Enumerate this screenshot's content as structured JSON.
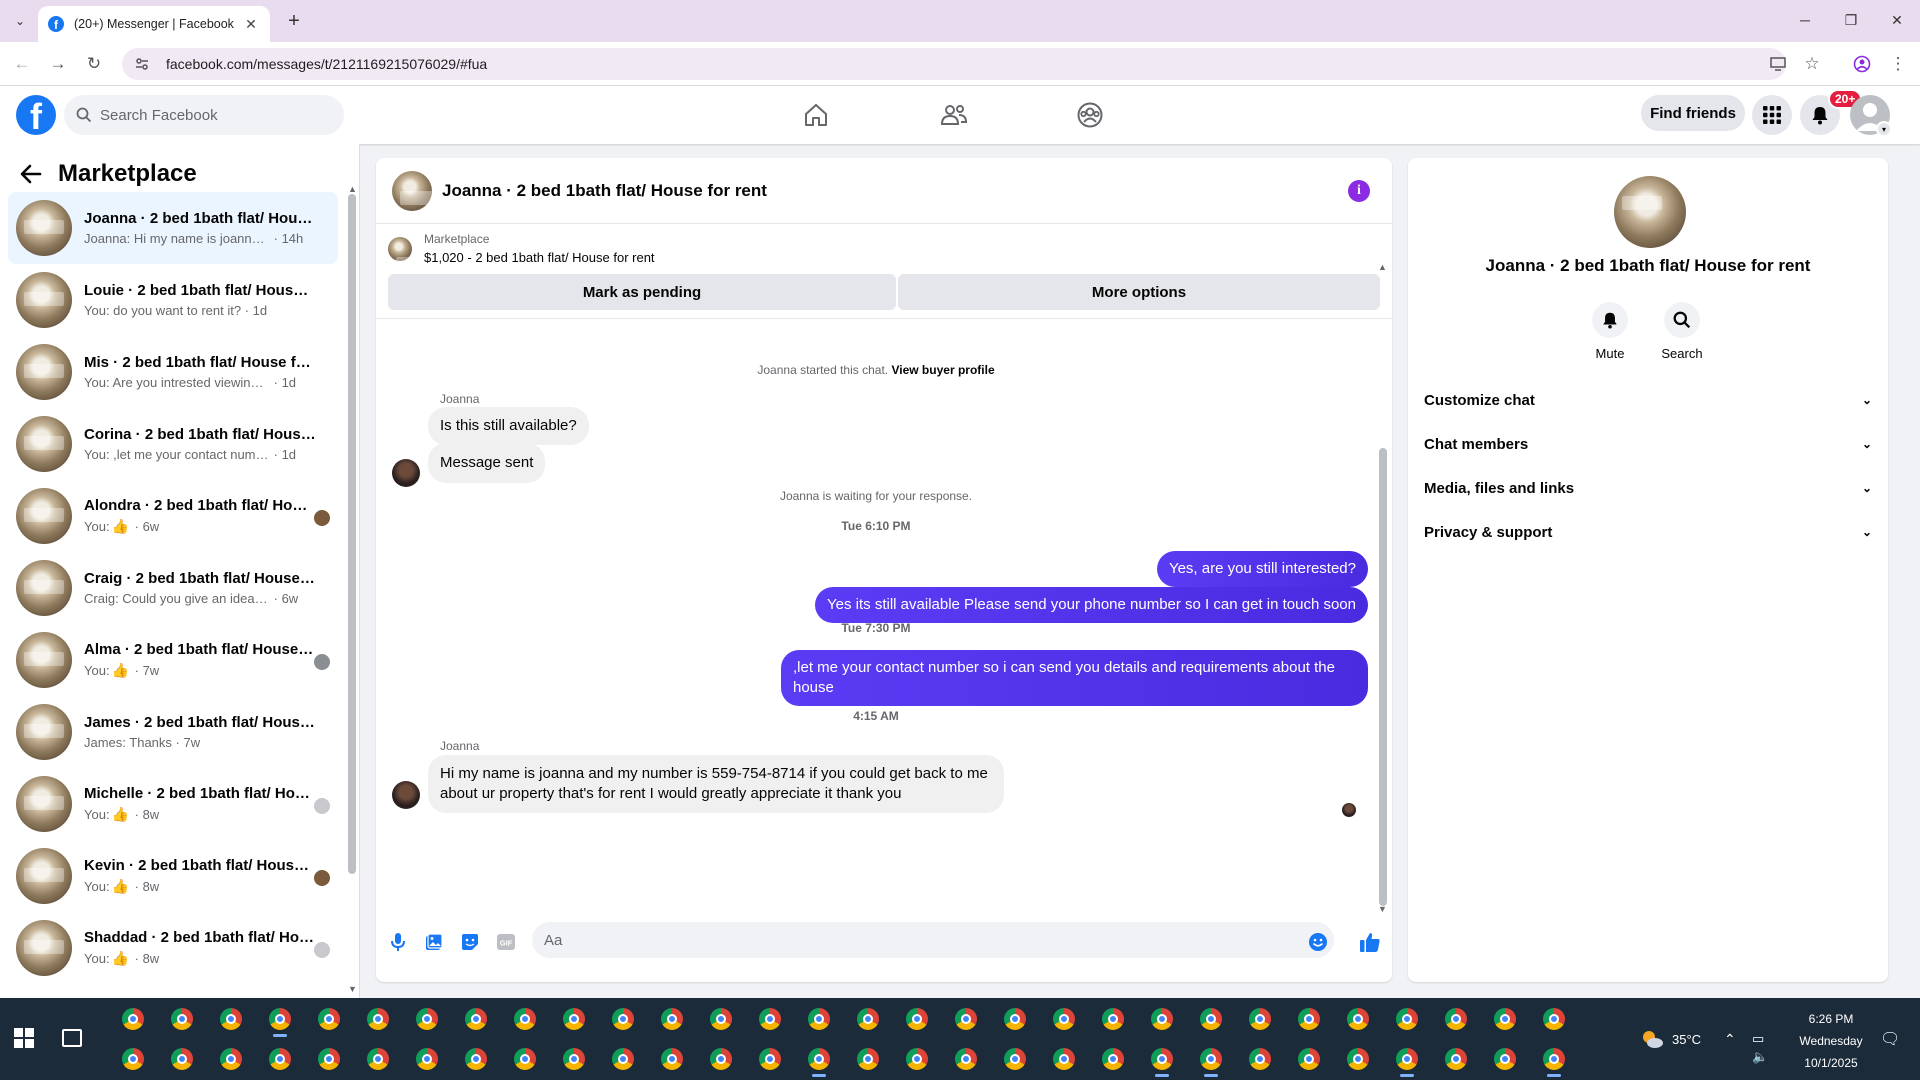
{
  "browser": {
    "tab_title": "(20+) Messenger | Facebook",
    "url": "facebook.com/messages/t/2121169215076029/#fua"
  },
  "colors": {
    "fb_blue": "#1877f2",
    "outgoing_bubble": "#5b3cf4",
    "notification_red": "#e41e3f",
    "info_purple": "#8b2be2"
  },
  "fbnav": {
    "search_placeholder": "Search Facebook",
    "find_friends": "Find friends",
    "notification_count": "20+"
  },
  "sidebar": {
    "title": "Marketplace",
    "conversations": [
      {
        "name": "Joanna · 2 bed 1bath flat/ House for rent",
        "preview": "Joanna: Hi my name is joanna and...",
        "time": "14h",
        "like": false,
        "active": true
      },
      {
        "name": "Louie · 2 bed 1bath flat/ House for rent",
        "preview": "You: do you want to rent it?",
        "time": "1d",
        "like": false
      },
      {
        "name": "Mis · 2 bed 1bath flat/ House for rent",
        "preview": "You: Are you intrested viewing the ...",
        "time": "1d",
        "like": false
      },
      {
        "name": "Corina · 2 bed 1bath flat/ House for rent",
        "preview": "You: ,let me your contact number s...",
        "time": "1d",
        "like": false
      },
      {
        "name": "Alondra · 2 bed 1bath flat/ House for rent",
        "preview": "You:",
        "time": "6w",
        "like": true
      },
      {
        "name": "Craig · 2 bed 1bath flat/ House for rent",
        "preview": "Craig: Could you give an idea of w...",
        "time": "6w",
        "like": false
      },
      {
        "name": "Alma · 2 bed 1bath flat/ House for rent",
        "preview": "You:",
        "time": "7w",
        "like": true
      },
      {
        "name": "James · 2 bed 1bath flat/ House for rent",
        "preview": "James: Thanks",
        "time": "7w",
        "like": false
      },
      {
        "name": "Michelle · 2 bed 1bath flat/ House for rent",
        "preview": "You:",
        "time": "8w",
        "like": true
      },
      {
        "name": "Kevin · 2 bed 1bath flat/ House for rent",
        "preview": "You:",
        "time": "8w",
        "like": true
      },
      {
        "name": "Shaddad · 2 bed 1bath flat/ House for rent",
        "preview": "You:",
        "time": "8w",
        "like": true
      }
    ]
  },
  "chat": {
    "title": "Joanna · 2 bed 1bath flat/ House for rent",
    "listing_label": "Marketplace",
    "listing_price": "$1,020 - 2 bed 1bath flat/ House for rent",
    "mark_pending": "Mark as pending",
    "more_options": "More options",
    "started": "Joanna started this chat.",
    "view_profile": "View buyer profile",
    "sender": "Joanna",
    "msg1": "Is this still available?",
    "msg2": "Message sent",
    "waiting": "Joanna is waiting for your response.",
    "ts1": "Tue 6:10 PM",
    "out1": "Yes, are you still interested?",
    "out2": "Yes its still available Please send your phone number so I can get in touch soon",
    "ts2": "Tue 7:30 PM",
    "out3": ",let me your contact number so i can send you details and requirements about the house",
    "ts3": "4:15 AM",
    "sender2": "Joanna",
    "msg3": "Hi my name is joanna and my number is 559-754-8714 if you could get back to me about ur property that's for rent I would greatly appreciate it thank you",
    "composer_placeholder": "Aa"
  },
  "info": {
    "name": "Joanna · 2 bed 1bath flat/ House for rent",
    "mute": "Mute",
    "search": "Search",
    "sections": [
      "Customize chat",
      "Chat members",
      "Media, files and links",
      "Privacy & support"
    ]
  },
  "taskbar": {
    "temperature": "35°C",
    "time": "6:26 PM",
    "day": "Wednesday",
    "date": "10/1/2025"
  }
}
